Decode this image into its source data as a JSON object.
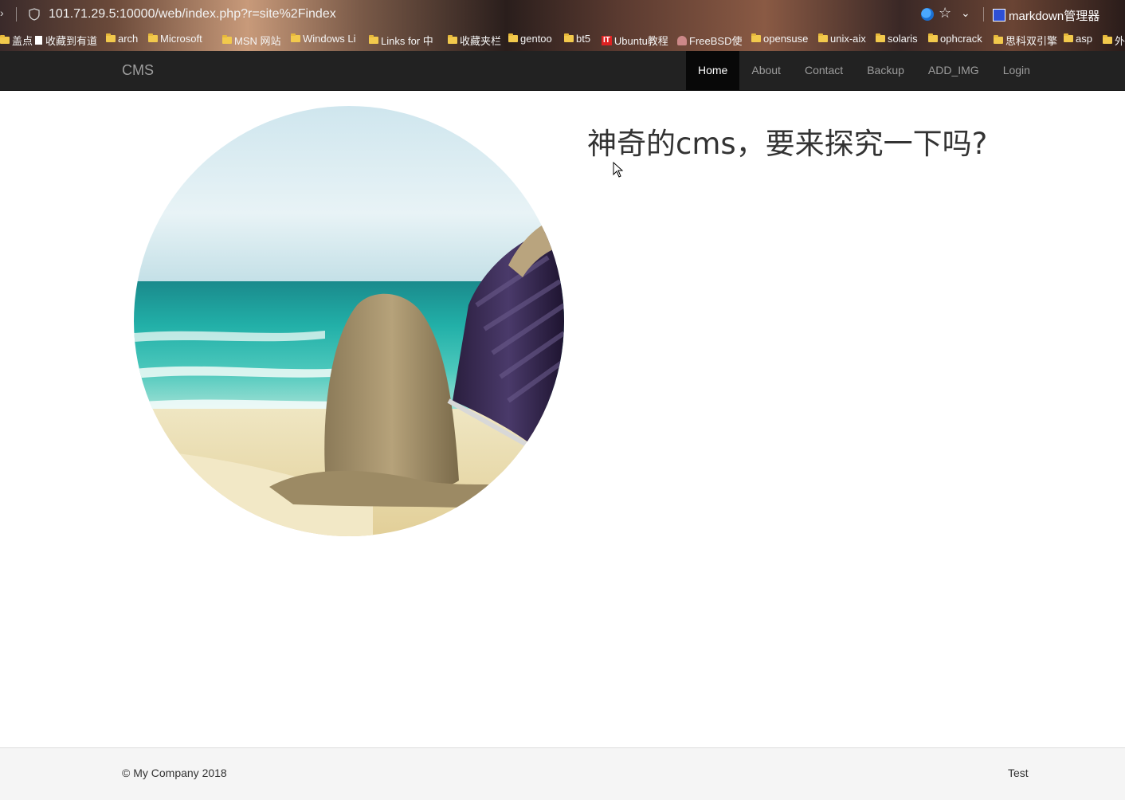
{
  "browser": {
    "url": "101.71.29.5:10000/web/index.php?r=site%2Findex",
    "extension_label": "markdown管理器",
    "bookmarks": [
      {
        "label": "盖点",
        "icon": "folder-icon"
      },
      {
        "label": "收藏到有道",
        "icon": "page-icon"
      },
      {
        "label": "arch",
        "icon": "folder-icon"
      },
      {
        "label": "Microsoft",
        "icon": "folder-icon"
      },
      {
        "label": "MSN 网站",
        "icon": "folder-icon"
      },
      {
        "label": "Windows Li",
        "icon": "folder-icon"
      },
      {
        "label": "Links for 中",
        "icon": "folder-icon"
      },
      {
        "label": "收藏夹栏",
        "icon": "folder-icon"
      },
      {
        "label": "gentoo",
        "icon": "folder-icon"
      },
      {
        "label": "bt5",
        "icon": "folder-icon"
      },
      {
        "label": "Ubuntu教程",
        "icon": "it-icon"
      },
      {
        "label": "FreeBSD使",
        "icon": "freebsd-icon"
      },
      {
        "label": "opensuse",
        "icon": "folder-icon"
      },
      {
        "label": "unix-aix",
        "icon": "folder-icon"
      },
      {
        "label": "solaris",
        "icon": "folder-icon"
      },
      {
        "label": "ophcrack",
        "icon": "folder-icon"
      },
      {
        "label": "思科双引擎",
        "icon": "folder-icon"
      },
      {
        "label": "asp",
        "icon": "folder-icon"
      },
      {
        "label": "外",
        "icon": "folder-icon"
      }
    ]
  },
  "navbar": {
    "brand": "CMS",
    "items": [
      {
        "label": "Home",
        "active": true
      },
      {
        "label": "About"
      },
      {
        "label": "Contact"
      },
      {
        "label": "Backup"
      },
      {
        "label": "ADD_IMG"
      },
      {
        "label": "Login"
      }
    ]
  },
  "main": {
    "headline": "神奇的cms，要来探究一下吗?"
  },
  "footer": {
    "copyright": "© My Company 2018",
    "right_text": "Test"
  },
  "colors": {
    "navbar_bg": "#222222",
    "active_nav_bg": "#080808",
    "footer_bg": "#f5f5f5"
  }
}
